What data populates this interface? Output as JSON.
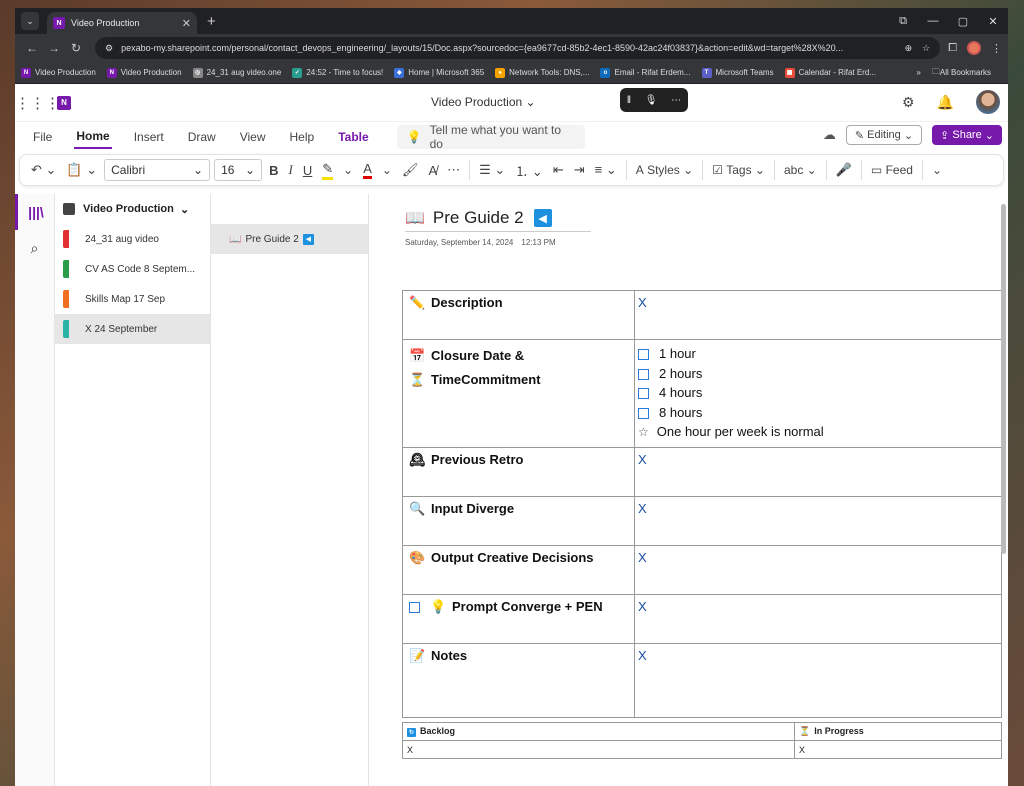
{
  "browser": {
    "tab_title": "Video Production",
    "url": "pexabo-my.sharepoint.com/personal/contact_devops_engineering/_layouts/15/Doc.aspx?sourcedoc={ea9677cd-85b2-4ec1-8590-42ac24f03837}&action=edit&wd=target%28X%20...",
    "bookmarks": [
      {
        "label": "Video Production",
        "color": "#7719aa",
        "glyph": "N"
      },
      {
        "label": "Video Production",
        "color": "#7719aa",
        "glyph": "N"
      },
      {
        "label": "24_31 aug video.one",
        "color": "#888888",
        "glyph": "◎"
      },
      {
        "label": "24:52 - Time to focus!",
        "color": "#2a9d8f",
        "glyph": "✓"
      },
      {
        "label": "Home | Microsoft 365",
        "color": "#3b6fd8",
        "glyph": "◆"
      },
      {
        "label": "Network Tools: DNS,...",
        "color": "#f4a300",
        "glyph": "●"
      },
      {
        "label": "Email - Rifat Erdem...",
        "color": "#0f6cbd",
        "glyph": "o"
      },
      {
        "label": "Microsoft Teams",
        "color": "#5b5fc7",
        "glyph": "T"
      },
      {
        "label": "Calendar - Rifat Erd...",
        "color": "#e74c3c",
        "glyph": "▦"
      }
    ],
    "all_bookmarks": "All Bookmarks"
  },
  "app": {
    "title": "Video Production",
    "menu": [
      "File",
      "Home",
      "Insert",
      "Draw",
      "View",
      "Help",
      "Table"
    ],
    "tell_me": "Tell me what you want to do",
    "editing": "Editing",
    "share": "Share",
    "font_name": "Calibri",
    "font_size": "16",
    "styles": "Styles",
    "tags": "Tags",
    "feed": "Feed"
  },
  "notebook": {
    "name": "Video Production",
    "sections": [
      {
        "label": "24_31 aug video",
        "color": "#e03030"
      },
      {
        "label": "CV AS Code 8 Septem...",
        "color": "#2a9d4a"
      },
      {
        "label": "Skills Map 17 Sep",
        "color": "#f07020"
      },
      {
        "label": "X 24 September",
        "color": "#2ab4a8"
      }
    ],
    "pages": [
      {
        "label": "Pre Guide 2"
      }
    ]
  },
  "page": {
    "title": "Pre Guide 2",
    "date": "Saturday, September 14, 2024",
    "time": "12:13 PM",
    "rows": [
      {
        "icon": "✏️",
        "label": "Description",
        "value": "X"
      },
      {
        "icon": "📅",
        "label": "Closure Date &",
        "label2": "TimeCommitment",
        "icon2": "⏳"
      },
      {
        "icon": "🕰",
        "label": "Previous Retro",
        "value": "X"
      },
      {
        "icon": "🔍",
        "label": "Input Diverge",
        "value": "X"
      },
      {
        "icon": "🎨",
        "label": "Output Creative Decisions",
        "value": "X"
      },
      {
        "icon": "💡",
        "label": "Prompt Converge  + PEN",
        "value": "X"
      },
      {
        "icon": "📝",
        "label": "Notes",
        "value": "X"
      }
    ],
    "time_options": [
      "1 hour",
      "2 hours",
      "4 hours",
      "8 hours"
    ],
    "time_note": "One hour per week is normal",
    "kanban": {
      "col1": "Backlog",
      "col2": "In Progress",
      "cell1": "X",
      "cell2": "X"
    }
  }
}
